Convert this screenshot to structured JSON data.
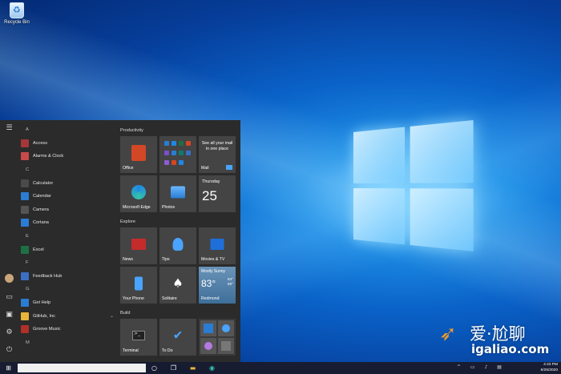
{
  "desktop": {
    "recycle_bin_label": "Recycle Bin"
  },
  "start_menu": {
    "app_list": [
      {
        "type": "letter",
        "text": "A"
      },
      {
        "type": "app",
        "text": "Access",
        "icon": "access-icon",
        "color": "#a4373a"
      },
      {
        "type": "app",
        "text": "Alarms & Clock",
        "icon": "alarm-icon",
        "color": "#c74a4a"
      },
      {
        "type": "letter",
        "text": "C"
      },
      {
        "type": "app",
        "text": "Calculator",
        "icon": "calculator-icon",
        "color": "#4a4a4a"
      },
      {
        "type": "app",
        "text": "Calendar",
        "icon": "calendar-icon",
        "color": "#2b7cd3"
      },
      {
        "type": "app",
        "text": "Camera",
        "icon": "camera-icon",
        "color": "#555555"
      },
      {
        "type": "app",
        "text": "Cortana",
        "icon": "cortana-icon",
        "color": "#2b7cd3"
      },
      {
        "type": "letter",
        "text": "E"
      },
      {
        "type": "app",
        "text": "Excel",
        "icon": "excel-icon",
        "color": "#1d7044"
      },
      {
        "type": "letter",
        "text": "F"
      },
      {
        "type": "app",
        "text": "Feedback Hub",
        "icon": "feedback-icon",
        "color": "#3a6fc4"
      },
      {
        "type": "letter",
        "text": "G"
      },
      {
        "type": "app",
        "text": "Get Help",
        "icon": "help-icon",
        "color": "#2b7cd3"
      },
      {
        "type": "app",
        "text": "GitHub, Inc",
        "icon": "folder-icon",
        "color": "#e8b43a",
        "expandable": true
      },
      {
        "type": "app",
        "text": "Groove Music",
        "icon": "music-icon",
        "color": "#b0302a"
      },
      {
        "type": "letter",
        "text": "M"
      }
    ],
    "groups": {
      "productivity": "Productivity",
      "explore": "Explore",
      "build": "Build"
    },
    "tiles": {
      "office": "Office",
      "mail_text": "See all your mail in one place",
      "mail": "Mail",
      "edge": "Microsoft Edge",
      "photos": "Photos",
      "cal_day": "Thursday",
      "cal_num": "25",
      "news": "News",
      "tips": "Tips",
      "movies": "Movies & TV",
      "your_phone": "Your Phone",
      "solitaire": "Solitaire",
      "weather_cond": "Mostly Sunny",
      "weather_temp": "83°",
      "weather_hi": "84°",
      "weather_lo": "60°",
      "weather_city": "Redmond",
      "terminal": "Terminal",
      "todo": "To Do"
    }
  },
  "taskbar": {
    "time": "4:43 PM",
    "date": "6/25/2020"
  },
  "watermark": {
    "chinese": "爱·尬聊",
    "url": "igaliao.com"
  },
  "colors": {
    "start_bg": "#2b2b2b",
    "tile_bg": "#444444",
    "office_red": "#d24726",
    "edge_blue": "#1e88e5",
    "accent_blue": "#0a62c8"
  }
}
